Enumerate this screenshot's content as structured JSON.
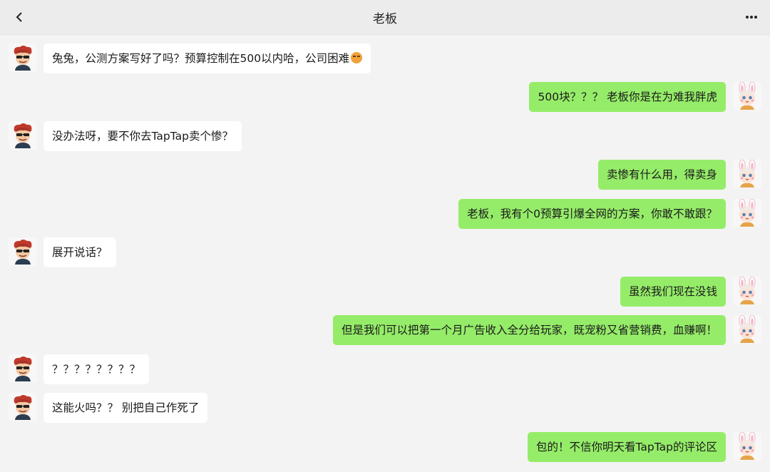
{
  "header": {
    "title": "老板"
  },
  "messages": [
    {
      "side": "left",
      "text": "兔兔，公测方案写好了吗？预算控制在500以内哈，公司困难",
      "emoji": "tired-face"
    },
    {
      "side": "right",
      "text": "500块？？？ 老板你是在为难我胖虎"
    },
    {
      "side": "left",
      "text": "没办法呀，要不你去TapTap卖个惨？"
    },
    {
      "side": "right",
      "text": "卖惨有什么用，得卖身"
    },
    {
      "side": "right",
      "text": "老板，我有个0预算引爆全网的方案，你敢不敢跟？"
    },
    {
      "side": "left",
      "text": "展开说话？"
    },
    {
      "side": "right",
      "text": "虽然我们现在没钱"
    },
    {
      "side": "right",
      "text": "但是我们可以把第一个月广告收入全分给玩家，既宠粉又省营销费，血赚啊！"
    },
    {
      "side": "left",
      "text": "？？？？？？？？"
    },
    {
      "side": "left",
      "text": "这能火吗？？ 别把自己作死了"
    },
    {
      "side": "right",
      "text": "包的！不信你明天看TapTap的评论区"
    }
  ]
}
